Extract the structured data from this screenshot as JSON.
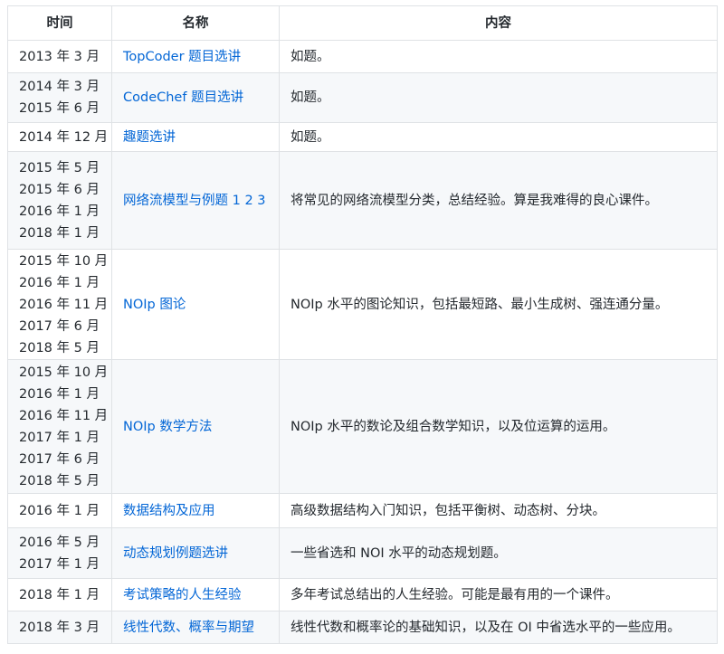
{
  "table": {
    "headers": {
      "time": "时间",
      "name": "名称",
      "desc": "内容"
    },
    "rows": [
      {
        "dates": [
          "2013 年 3 月"
        ],
        "name": "TopCoder 题目选讲",
        "desc": "如题。"
      },
      {
        "dates": [
          "2014 年 3 月",
          "2015 年 6 月"
        ],
        "name": "CodeChef 题目选讲",
        "desc": "如题。"
      },
      {
        "dates": [
          "2014 年 12 月"
        ],
        "name": "趣题选讲",
        "desc": "如题。"
      },
      {
        "dates": [
          "2015 年 5 月",
          "2015 年 6 月",
          "2016 年 1 月",
          "2018 年 1 月"
        ],
        "name": "网络流模型与例题 1 2 3",
        "desc": "将常见的网络流模型分类，总结经验。算是我难得的良心课件。"
      },
      {
        "dates": [
          "2015 年 10 月",
          "2016 年 1 月",
          "2016 年 11 月",
          "2017 年 6 月",
          "2018 年 5 月"
        ],
        "name": "NOIp 图论",
        "desc": "NOIp 水平的图论知识，包括最短路、最小生成树、强连通分量。"
      },
      {
        "dates": [
          "2015 年 10 月",
          "2016 年 1 月",
          "2016 年 11 月",
          "2017 年 1 月",
          "2017 年 6 月",
          "2018 年 5 月"
        ],
        "name": "NOIp 数学方法",
        "desc": "NOIp 水平的数论及组合数学知识，以及位运算的运用。"
      },
      {
        "dates": [
          "2016 年 1 月"
        ],
        "name": "数据结构及应用",
        "desc": "高级数据结构入门知识，包括平衡树、动态树、分块。"
      },
      {
        "dates": [
          "2016 年 5 月",
          "2017 年 1 月"
        ],
        "name": "动态规划例题选讲",
        "desc": "一些省选和 NOI 水平的动态规划题。"
      },
      {
        "dates": [
          "2018 年 1 月"
        ],
        "name": "考试策略的人生经验",
        "desc": "多年考试总结出的人生经验。可能是最有用的一个课件。"
      },
      {
        "dates": [
          "2018 年 3 月"
        ],
        "name": "线性代数、概率与期望",
        "desc": "线性代数和概率论的基础知识，以及在 OI 中省选水平的一些应用。"
      }
    ]
  },
  "colors": {
    "link": "#0366d6",
    "text": "#24292e",
    "border": "#dfe2e5",
    "stripe": "#f6f8fa"
  }
}
